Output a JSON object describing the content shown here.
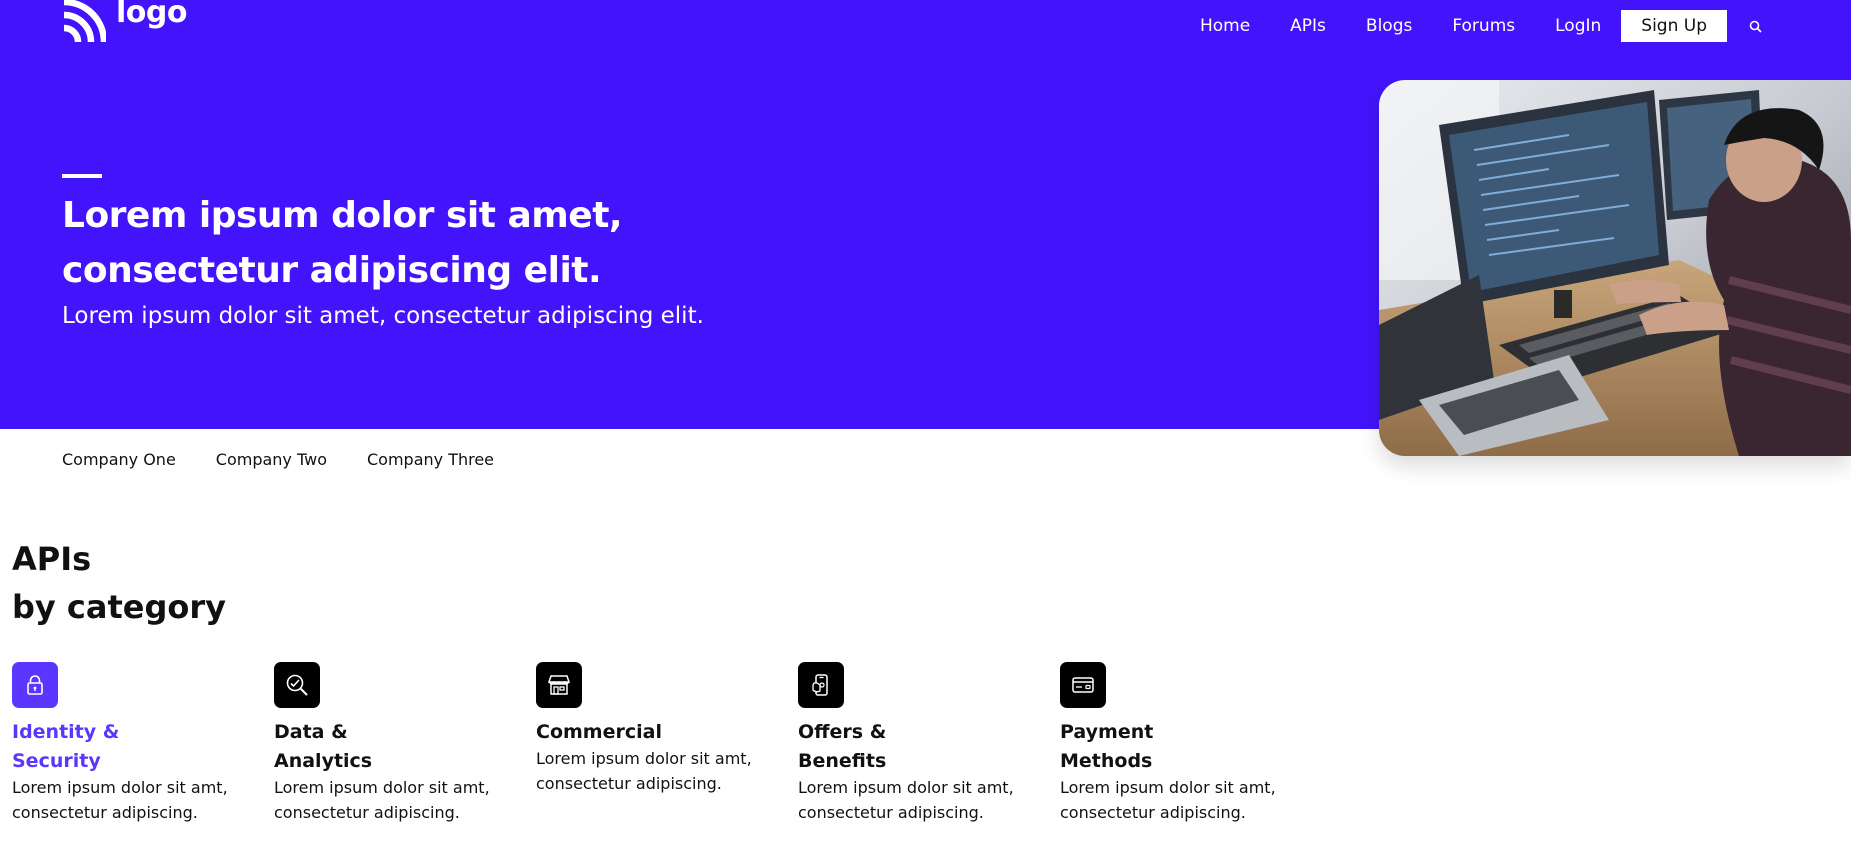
{
  "header": {
    "logo_text": "logo",
    "nav": [
      {
        "label": "Home"
      },
      {
        "label": "APIs"
      },
      {
        "label": "Blogs"
      },
      {
        "label": "Forums"
      },
      {
        "label": "LogIn"
      }
    ],
    "signup_label": "Sign Up",
    "search_icon": "search-icon"
  },
  "hero": {
    "title_line1": "Lorem ipsum dolor sit amet,",
    "title_line2": "consectetur adipiscing elit.",
    "subtitle": "Lorem ipsum dolor sit amet, consectetur adipiscing elit.",
    "image": "developer-at-computers-photo"
  },
  "companies": [
    "Company One",
    "Company Two",
    "Company Three"
  ],
  "section": {
    "title_line1": "APIs",
    "title_line2": "by category"
  },
  "categories": [
    {
      "icon": "lock-icon",
      "title_line1": "Identity &",
      "title_line2": "Security",
      "desc_line1": "Lorem ipsum dolor sit amt,",
      "desc_line2": "consectetur adipiscing.",
      "active": true
    },
    {
      "icon": "magnifier-chart-icon",
      "title_line1": "Data &",
      "title_line2": "Analytics",
      "desc_line1": "Lorem ipsum dolor sit amt,",
      "desc_line2": "consectetur adipiscing.",
      "active": false
    },
    {
      "icon": "storefront-icon",
      "title_line1": "Commercial",
      "title_line2": "",
      "desc_line1": "Lorem ipsum dolor sit amt,",
      "desc_line2": "consectetur adipiscing.",
      "active": false
    },
    {
      "icon": "mobile-offer-icon",
      "title_line1": "Offers &",
      "title_line2": "Benefits",
      "desc_line1": "Lorem ipsum dolor sit amt,",
      "desc_line2": "consectetur adipiscing.",
      "active": false
    },
    {
      "icon": "credit-card-icon",
      "title_line1": "Payment",
      "title_line2": "Methods",
      "desc_line1": "Lorem ipsum dolor sit amt,",
      "desc_line2": "consectetur adipiscing.",
      "active": false
    }
  ],
  "colors": {
    "brand": "#4314fb",
    "accent": "#5b36ff",
    "white": "#ffffff",
    "text": "#111111"
  }
}
